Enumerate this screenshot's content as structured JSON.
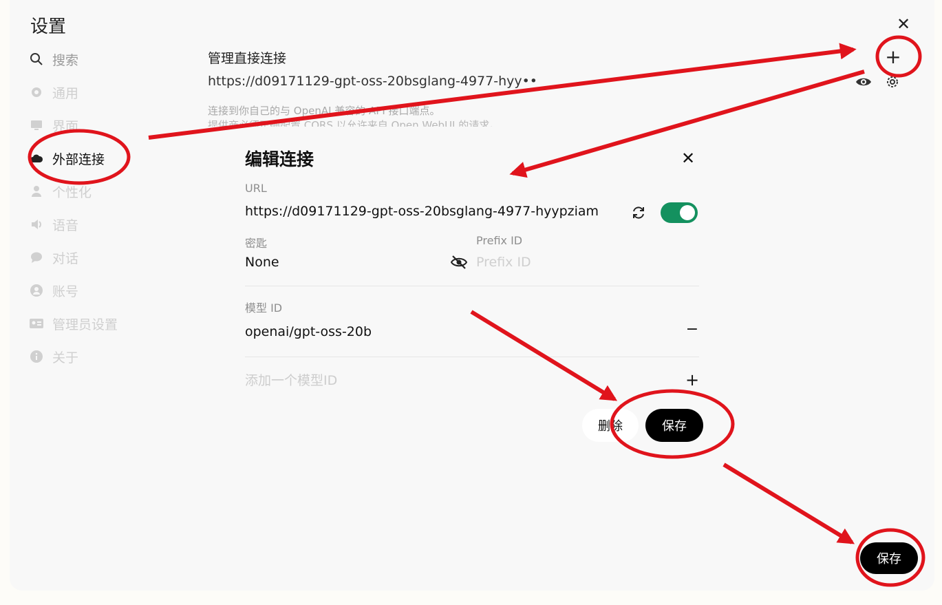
{
  "settings": {
    "title": "设置"
  },
  "sidebar": {
    "items": [
      {
        "label": "搜索",
        "icon": "search-icon"
      },
      {
        "label": "通用",
        "icon": "gear-icon"
      },
      {
        "label": "界面",
        "icon": "monitor-icon"
      },
      {
        "label": "外部连接",
        "icon": "cloud-icon"
      },
      {
        "label": "个性化",
        "icon": "user-icon"
      },
      {
        "label": "语音",
        "icon": "speaker-icon"
      },
      {
        "label": "对话",
        "icon": "chat-icon"
      },
      {
        "label": "账号",
        "icon": "account-icon"
      },
      {
        "label": "管理员设置",
        "icon": "id-card-icon"
      },
      {
        "label": "关于",
        "icon": "info-icon"
      }
    ]
  },
  "direct": {
    "title": "管理直接连接",
    "url": "https://d09171129-gpt-oss-20bsglang-4977-hyy••",
    "hint_line1": "连接到你自己的与 OpenAI 兼容的 API 接口端点。",
    "hint_line2": "提供商必须正确配置 CORS 以允许来自 Open WebUI 的请求。"
  },
  "modal": {
    "title": "编辑连接",
    "url_label": "URL",
    "url_value": "https://d09171129-gpt-oss-20bsglang-4977-hyypziam",
    "key_label": "密匙",
    "key_value": "None",
    "prefix_label": "Prefix ID",
    "prefix_placeholder": "Prefix ID",
    "model_label": "模型 ID",
    "model_value": "openai/gpt-oss-20b",
    "add_model_placeholder": "添加一个模型ID",
    "delete_label": "删除",
    "save_label": "保存"
  },
  "footer": {
    "save_label": "保存"
  },
  "colors": {
    "accent_toggle": "#14915f",
    "annotation": "#e0141c"
  }
}
